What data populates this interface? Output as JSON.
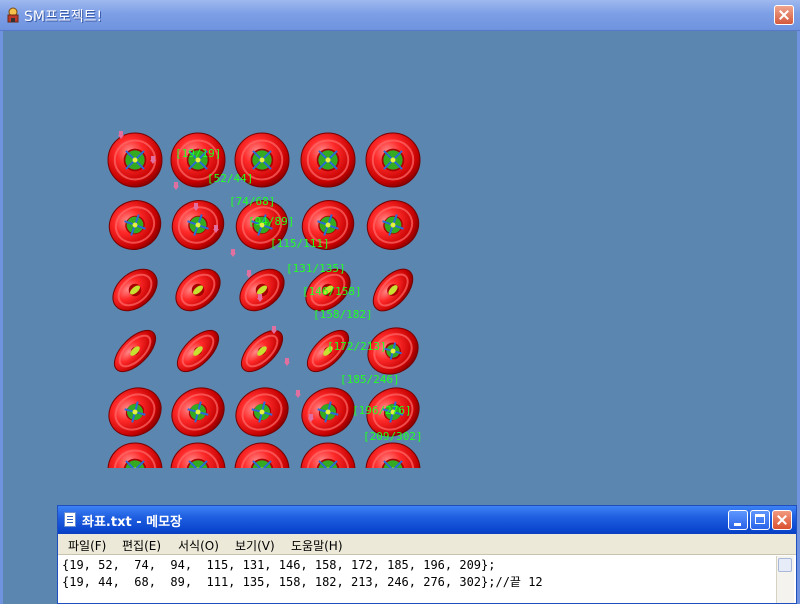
{
  "app": {
    "title": "SM프로젝트!"
  },
  "sprite_labels": [
    "[19/19]",
    "[52/44]",
    "[74/68]",
    "[94/89]",
    "[115/111]",
    "[131/135]",
    "[146/158]",
    "[158/182]",
    "[172/213]",
    "[185/246]",
    "[196/276]",
    "[209/302]"
  ],
  "notepad": {
    "title": "좌표.txt - 메모장",
    "menu": [
      "파일(F)",
      "편집(E)",
      "서식(O)",
      "보기(V)",
      "도움말(H)"
    ],
    "lines": [
      "{19, 52,  74,  94,  115, 131, 146, 158, 172, 185, 196, 209};",
      "{19, 44,  68,  89,  111, 135, 158, 182, 213, 246, 276, 302};//끝 12"
    ]
  },
  "colors": {
    "desktop": "#5b86af",
    "ring_red": "#e02020",
    "label_green": "#22ff22",
    "marker_pink": "#e070a0"
  },
  "icons": {
    "app": "app-icon",
    "close": "close-icon",
    "notepad": "notepad-icon",
    "minimize": "minimize-icon",
    "maximize": "maximize-icon"
  }
}
